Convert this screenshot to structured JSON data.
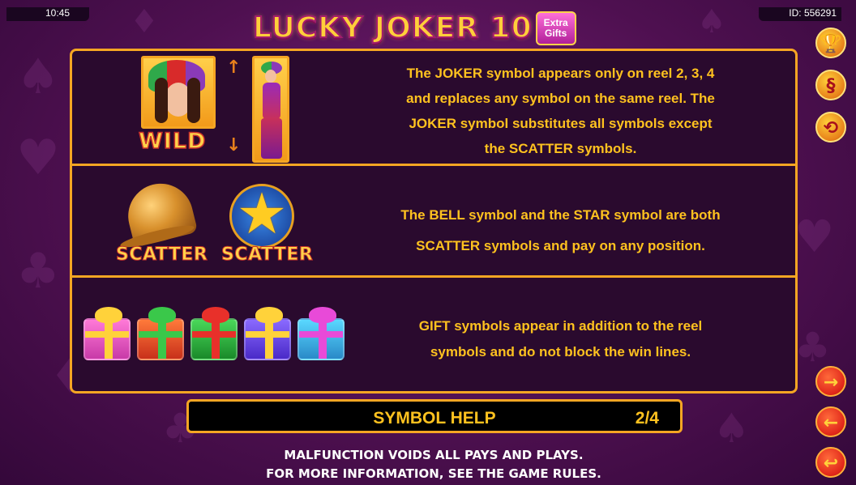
{
  "status": {
    "time": "10:45",
    "id": "ID: 556291"
  },
  "logo": {
    "title": "LUCKY JOKER 10",
    "badge_line1": "Extra",
    "badge_line2": "Gifts"
  },
  "rows": {
    "wild": {
      "label": "WILD",
      "lines": [
        "The JOKER symbol appears only on reel 2, 3, 4",
        "and replaces any symbol on the same reel. The",
        "JOKER symbol substitutes all symbols except",
        "the SCATTER symbols."
      ]
    },
    "scatter": {
      "label_bell": "SCATTER",
      "label_star": "SCATTER",
      "lines": [
        "The BELL symbol and the STAR symbol are both",
        "SCATTER symbols and pay on any position."
      ]
    },
    "gift": {
      "lines": [
        "GIFT symbols appear in addition to the reel",
        "symbols and do not block the win lines."
      ]
    }
  },
  "help": {
    "title": "SYMBOL HELP",
    "page": "2/4"
  },
  "footer": {
    "line1": "MALFUNCTION VOIDS ALL PAYS AND PLAYS.",
    "line2": "FOR MORE INFORMATION, SEE THE GAME RULES."
  },
  "side_buttons": {
    "trophy": "trophy-icon",
    "rules": "§",
    "history": "history-icon",
    "next": "→",
    "prev": "←",
    "back": "↩"
  },
  "colors": {
    "accent": "#f5a623",
    "text": "#ffc21f",
    "background": "#4e1050"
  }
}
